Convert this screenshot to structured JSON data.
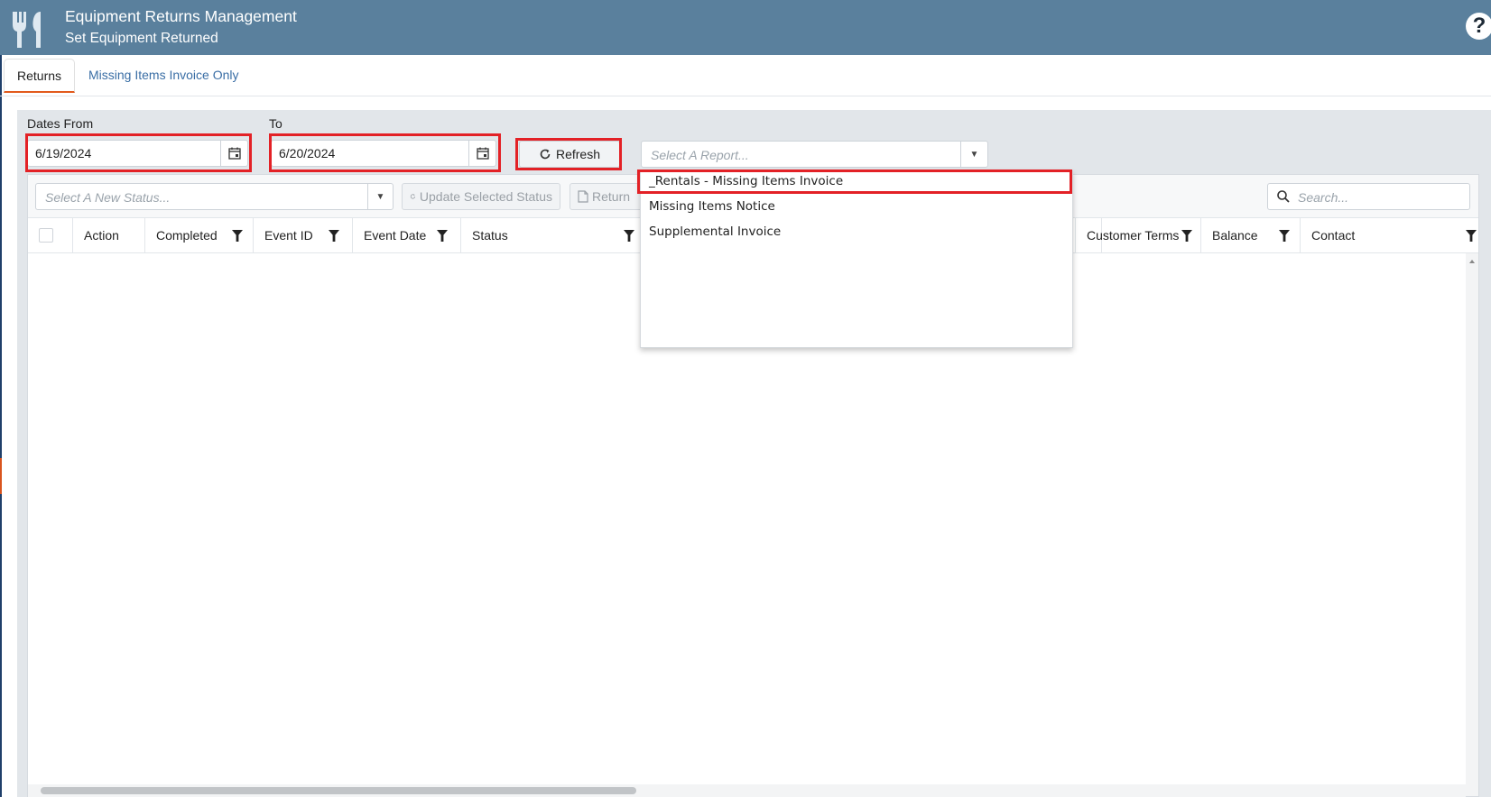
{
  "header": {
    "title": "Equipment Returns Management",
    "subtitle": "Set Equipment Returned",
    "help_glyph": "?"
  },
  "tabs": [
    {
      "label": "Returns",
      "active": true
    },
    {
      "label": "Missing Items Invoice Only",
      "active": false
    }
  ],
  "filters": {
    "dates_from_label": "Dates From",
    "dates_from_value": "6/19/2024",
    "to_label": "To",
    "to_value": "6/20/2024",
    "refresh_label": "Refresh",
    "report_placeholder": "Select A Report..."
  },
  "report_options": [
    "_Rentals - Missing Items Invoice",
    "Missing Items Notice",
    "Supplemental Invoice"
  ],
  "toolbar": {
    "status_placeholder": "Select A New Status...",
    "update_label": "Update Selected Status",
    "return_label": "Return",
    "search_placeholder": "Search..."
  },
  "columns": [
    {
      "label": "Action"
    },
    {
      "label": "Completed"
    },
    {
      "label": "Event ID"
    },
    {
      "label": "Event Date"
    },
    {
      "label": "Status"
    },
    {
      "label": "Customer Terms"
    },
    {
      "label": "Balance"
    },
    {
      "label": "Contact"
    }
  ],
  "colors": {
    "header_bg": "#5a809d",
    "highlight": "#e32126",
    "tab_accent": "#e25a1c",
    "link": "#3a6ea5"
  },
  "icons": [
    "fork-knife-icon",
    "help-icon",
    "calendar-icon",
    "refresh-icon",
    "chevron-down-icon",
    "search-icon",
    "filter-icon",
    "document-icon"
  ]
}
